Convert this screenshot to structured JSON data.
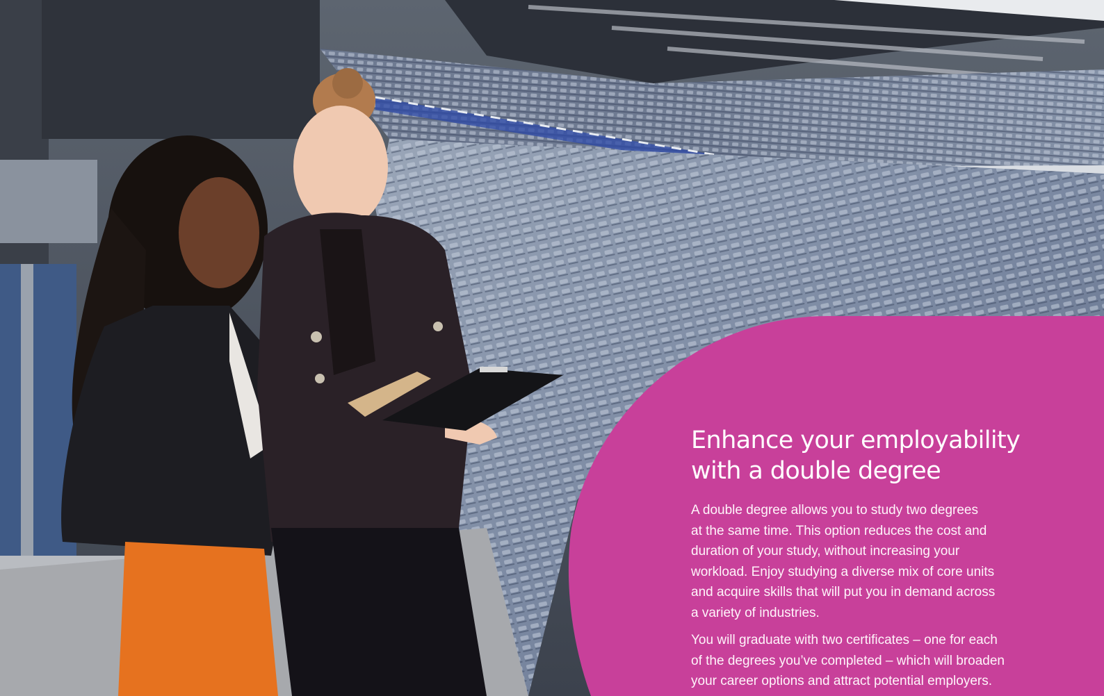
{
  "photo": {
    "subject": "two-women-reviewing-clipboard-and-tablet-in-stadium"
  },
  "panel": {
    "color": "#c8409a"
  },
  "section": {
    "heading_lines": [
      "Enhance your employability",
      "with a double degree"
    ],
    "paragraph1_lines": [
      "A double degree allows you to study two degrees",
      "at the same time. This option reduces the cost and",
      "duration of your study, without increasing your",
      "workload. Enjoy studying a diverse mix of core units",
      "and acquire skills that will put you in demand across",
      "a variety of industries."
    ],
    "paragraph2_lines": [
      "You will graduate with two certificates – one for each",
      "of the degrees you’ve completed – which will broaden",
      "your career options and attract potential employers."
    ]
  }
}
